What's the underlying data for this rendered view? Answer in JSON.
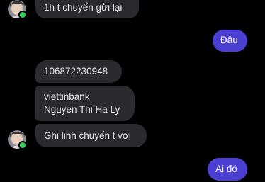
{
  "conversation": {
    "messages": [
      {
        "direction": "incoming",
        "lines": [
          "1h t chuyển gửi lại"
        ]
      },
      {
        "direction": "outgoing",
        "lines": [
          "Đâu"
        ]
      },
      {
        "direction": "incoming",
        "lines": [
          "106872230948"
        ]
      },
      {
        "direction": "incoming",
        "lines": [
          "viettinbank",
          "Nguyen Thi Ha Ly"
        ]
      },
      {
        "direction": "incoming",
        "lines": [
          "Ghi linh chuyển t với"
        ]
      },
      {
        "direction": "outgoing",
        "lines": [
          "Ai đó"
        ]
      }
    ]
  },
  "colors": {
    "background": "#000000",
    "incoming_bubble": "#2b2b2f",
    "outgoing_bubble": "#4b3fd3",
    "online_indicator": "#31d158"
  }
}
